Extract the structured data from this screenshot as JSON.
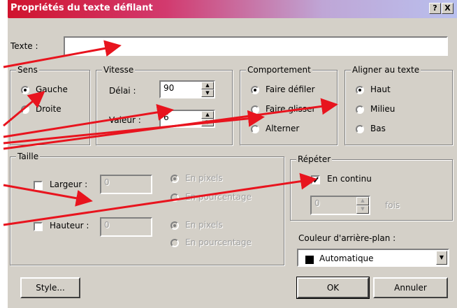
{
  "window": {
    "title": "Propriétés du texte défilant",
    "help_label": "?",
    "close_label": "X"
  },
  "texte": {
    "label": "Texte :",
    "value": ""
  },
  "sens": {
    "title": "Sens",
    "options": [
      {
        "label": "Gauche",
        "selected": true
      },
      {
        "label": "Droite",
        "selected": false
      }
    ]
  },
  "vitesse": {
    "title": "Vitesse",
    "delai_label": "Délai :",
    "delai_value": "90",
    "valeur_label": "Valeur :",
    "valeur_value": "6"
  },
  "comportement": {
    "title": "Comportement",
    "options": [
      {
        "label": "Faire défiler",
        "selected": true
      },
      {
        "label": "Faire glisser",
        "selected": false
      },
      {
        "label": "Alterner",
        "selected": false
      }
    ]
  },
  "aligner": {
    "title": "Aligner au texte",
    "options": [
      {
        "label": "Haut",
        "selected": true
      },
      {
        "label": "Milieu",
        "selected": false
      },
      {
        "label": "Bas",
        "selected": false
      }
    ]
  },
  "taille": {
    "title": "Taille",
    "largeur": {
      "label": "Largeur :",
      "value": "0",
      "unit_pixels": "En pixels",
      "unit_percent": "En pourcentage"
    },
    "hauteur": {
      "label": "Hauteur :",
      "value": "0",
      "unit_pixels": "En pixels",
      "unit_percent": "En pourcentage"
    }
  },
  "repeter": {
    "title": "Répéter",
    "continu_label": "En continu",
    "continu_checked": true,
    "count_value": "0",
    "fois_label": "fois"
  },
  "couleur": {
    "label": "Couleur d'arrière-plan :",
    "selected": "Automatique",
    "swatch": "#000000"
  },
  "buttons": {
    "style": "Style...",
    "ok": "OK",
    "cancel": "Annuler"
  },
  "annotation": {
    "arrow_color": "#e8141e"
  }
}
